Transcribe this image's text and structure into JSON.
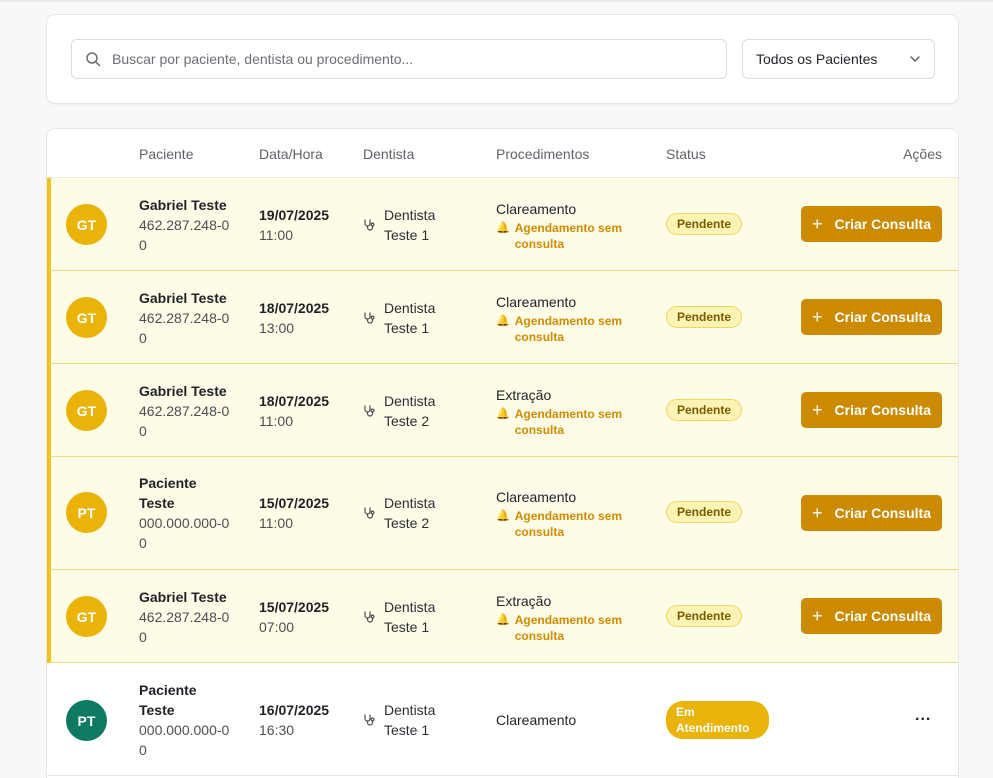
{
  "search": {
    "placeholder": "Buscar por paciente, dentista ou procedimento..."
  },
  "filter": {
    "selected": "Todos os Pacientes"
  },
  "table": {
    "headers": {
      "patient": "Paciente",
      "datetime": "Data/Hora",
      "dentist": "Dentista",
      "procedures": "Procedimentos",
      "status": "Status",
      "actions": "Ações"
    },
    "rows": [
      {
        "initials": "GT",
        "name": "Gabriel Teste",
        "doc": "462.287.248-00",
        "date": "19/07/2025",
        "time": "11:00",
        "dentist": "Dentista Teste 1",
        "procedure": "Clareamento",
        "warning": "Agendamento sem consulta",
        "status": "Pendente",
        "action": "Criar Consulta"
      },
      {
        "initials": "GT",
        "name": "Gabriel Teste",
        "doc": "462.287.248-00",
        "date": "18/07/2025",
        "time": "13:00",
        "dentist": "Dentista Teste 1",
        "procedure": "Clareamento",
        "warning": "Agendamento sem consulta",
        "status": "Pendente",
        "action": "Criar Consulta"
      },
      {
        "initials": "GT",
        "name": "Gabriel Teste",
        "doc": "462.287.248-00",
        "date": "18/07/2025",
        "time": "11:00",
        "dentist": "Dentista Teste 2",
        "procedure": "Extração",
        "warning": "Agendamento sem consulta",
        "status": "Pendente",
        "action": "Criar Consulta"
      },
      {
        "initials": "PT",
        "name": "Paciente Teste",
        "doc": "000.000.000-00",
        "date": "15/07/2025",
        "time": "11:00",
        "dentist": "Dentista Teste 2",
        "procedure": "Clareamento",
        "warning": "Agendamento sem consulta",
        "status": "Pendente",
        "action": "Criar Consulta"
      },
      {
        "initials": "GT",
        "name": "Gabriel Teste",
        "doc": "462.287.248-00",
        "date": "15/07/2025",
        "time": "07:00",
        "dentist": "Dentista Teste 1",
        "procedure": "Extração",
        "warning": "Agendamento sem consulta",
        "status": "Pendente",
        "action": "Criar Consulta"
      },
      {
        "initials": "PT",
        "name": "Paciente Teste",
        "doc": "000.000.000-00",
        "date": "16/07/2025",
        "time": "16:30",
        "dentist": "Dentista Teste 1",
        "procedure": "Clareamento",
        "status": "Em Atendimento",
        "action": "..."
      }
    ]
  },
  "colors": {
    "accent": "#cc8a00",
    "avatar_yellow": "#e9b308",
    "avatar_teal": "#0e7a61",
    "row_highlight": "#fefbe6"
  },
  "icons": {
    "search": "search-icon",
    "chevron": "chevron-down-icon",
    "dentist": "stethoscope-icon",
    "warning": "bell-icon",
    "add": "plus-icon",
    "more": "more-horizontal-icon"
  }
}
